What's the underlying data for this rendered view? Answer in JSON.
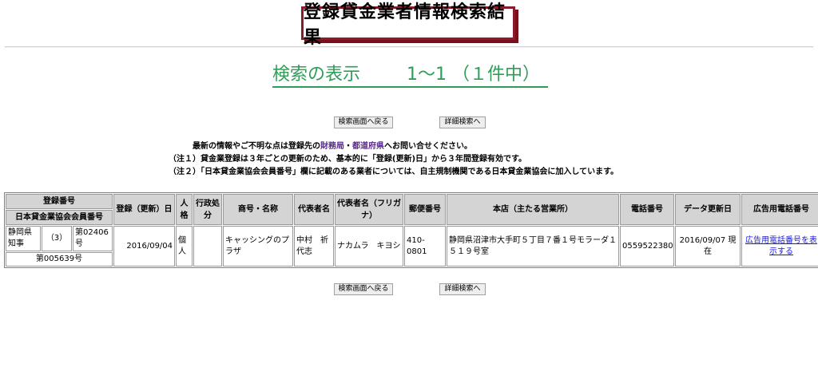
{
  "page_title": "登録貸金業者情報検索結果",
  "result_summary": {
    "label": "検索の表示",
    "range": "1～1 （１件中）"
  },
  "buttons": {
    "back_to_search": "検索画面へ戻る",
    "advanced_search": "詳細検索へ"
  },
  "notes": {
    "line1_prefix": "最新の情報やご不明な点は登録先の",
    "line1_link1": "財務局",
    "line1_sep": "・",
    "line1_link2": "都道府県",
    "line1_suffix": "へお問い合せください。",
    "note1": "（注１）貸金業登録は３年ごとの更新のため、基本的に「登録(更新)日」から３年間登録有効です。",
    "note2": "（注２）「日本貸金業協会会員番号」欄に記載のある業者については、自主規制機関である日本貸金業協会に加入しています。"
  },
  "table": {
    "headers": {
      "reg_number": "登録番号",
      "assoc_number": "日本貸金業協会会員番号",
      "reg_date": "登録（更新）日",
      "personality": "人格",
      "admin_action": "行政処分",
      "trade_name": "商号・名称",
      "representative": "代表者名",
      "rep_kana": "代表者名（フリガナ）",
      "postal": "郵便番号",
      "head_office": "本店（主たる営業所）",
      "phone": "電話番号",
      "data_updated": "データ更新日",
      "ad_phone": "広告用電話番号"
    },
    "row": {
      "authority": "静岡県知事",
      "renewal_count": "（3）",
      "reg_no": "第02406号",
      "assoc_no": "第005639号",
      "reg_date": "2016/09/04",
      "personality": "個人",
      "admin_action": "",
      "trade_name": "キャッシングのプラザ",
      "representative": "中村　祈代志",
      "rep_kana": "ナカムラ　キヨシ",
      "postal": "410-0801",
      "head_office": "静岡県沼津市大手町５丁目７番１号モラーダ１　５１９号室",
      "phone": "0559522380",
      "data_updated": "2016/09/07 現在",
      "ad_phone_link": "広告用電話番号を表示する"
    }
  }
}
